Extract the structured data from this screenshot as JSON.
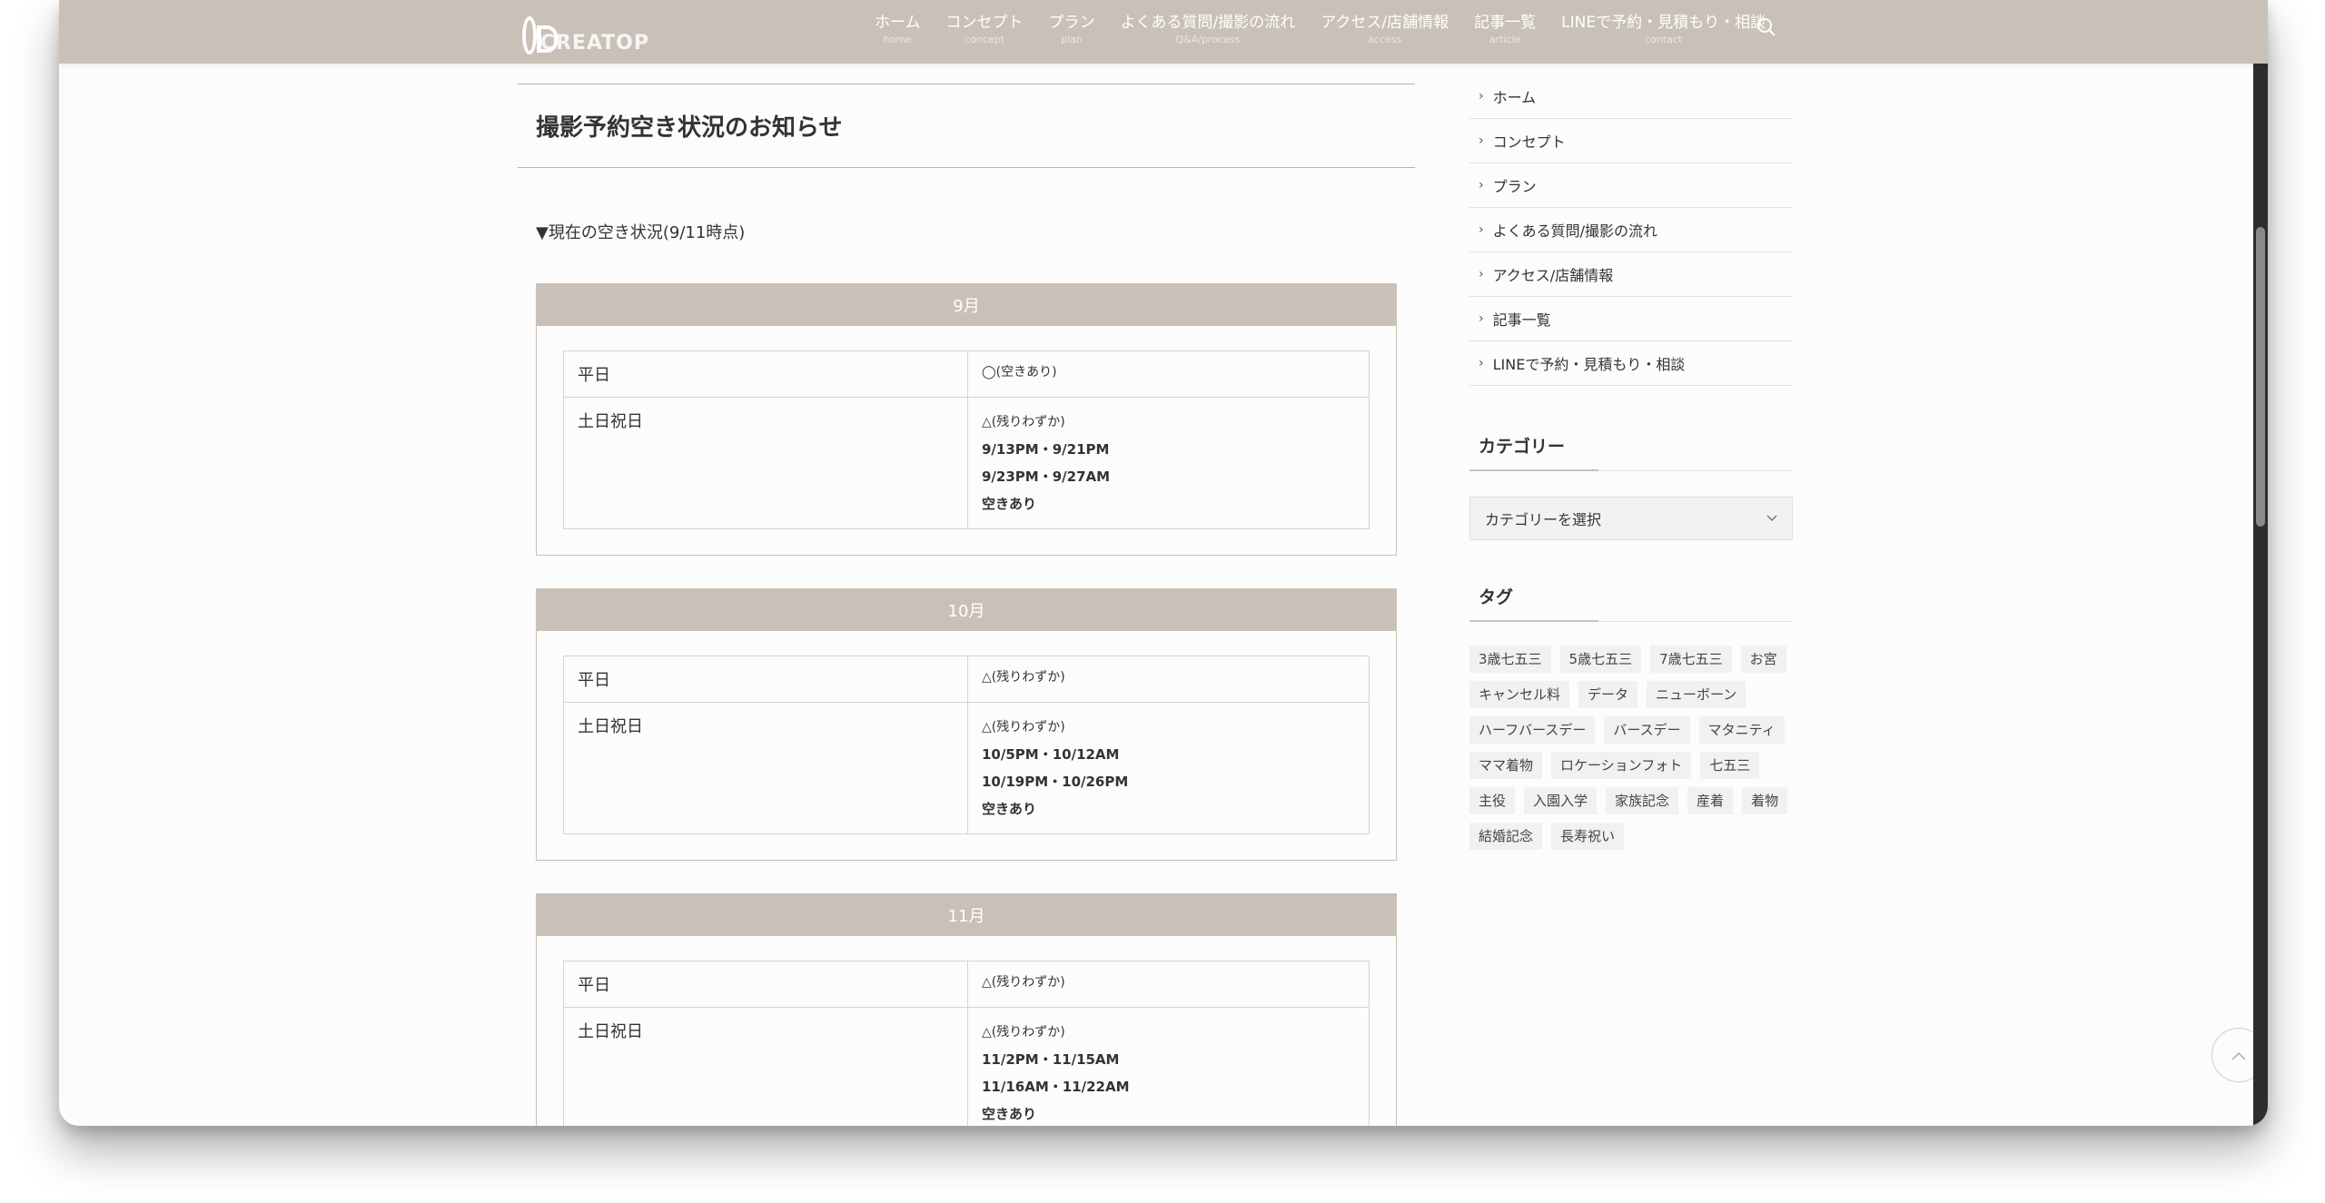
{
  "header": {
    "logo_text": "CREATOP",
    "nav": [
      {
        "label": "ホーム",
        "sub": "home"
      },
      {
        "label": "コンセプト",
        "sub": "concept"
      },
      {
        "label": "プラン",
        "sub": "plan"
      },
      {
        "label": "よくある質問/撮影の流れ",
        "sub": "Q&A/process"
      },
      {
        "label": "アクセス/店舗情報",
        "sub": "access"
      },
      {
        "label": "記事一覧",
        "sub": "article"
      },
      {
        "label": "LINEで予約・見積もり・相談",
        "sub": "contact"
      }
    ],
    "search_icon": "search-icon"
  },
  "main": {
    "title": "撮影予約空き状況のお知らせ",
    "status_note": "▼現在の空き状況(9/11時点)",
    "months": [
      {
        "name": "9月",
        "weekday_label": "平日",
        "weekday_value": "◯(空きあり)",
        "weekend_label": "土日祝日",
        "weekend_mark": "△(残りわずか)",
        "slots": [
          "9/13PM・9/21PM",
          "9/23PM・9/27AM",
          "空きあり"
        ]
      },
      {
        "name": "10月",
        "weekday_label": "平日",
        "weekday_value": "△(残りわずか)",
        "weekend_label": "土日祝日",
        "weekend_mark": "△(残りわずか)",
        "slots": [
          "10/5PM・10/12AM",
          "10/19PM・10/26PM",
          "空きあり"
        ]
      },
      {
        "name": "11月",
        "weekday_label": "平日",
        "weekday_value": "△(残りわずか)",
        "weekend_label": "土日祝日",
        "weekend_mark": "△(残りわずか)",
        "slots": [
          "11/2PM・11/15AM",
          "11/16AM・11/22AM",
          "空きあり"
        ]
      }
    ]
  },
  "sidebar": {
    "links": [
      "ホーム",
      "コンセプト",
      "プラン",
      "よくある質問/撮影の流れ",
      "アクセス/店舗情報",
      "記事一覧",
      "LINEで予約・見積もり・相談"
    ],
    "category_title": "カテゴリー",
    "category_select": "カテゴリーを選択",
    "tag_title": "タグ",
    "tags": [
      "3歳七五三",
      "5歳七五三",
      "7歳七五三",
      "お宮",
      "キャンセル料",
      "データ",
      "ニューボーン",
      "ハーフバースデー",
      "バースデー",
      "マタニティ",
      "ママ着物",
      "ロケーションフォト",
      "七五三",
      "主役",
      "入園入学",
      "家族記念",
      "産着",
      "着物",
      "結婚記念",
      "長寿祝い"
    ]
  },
  "colors": {
    "accent": "#c9c1b7",
    "background": "#fcfcfc"
  }
}
